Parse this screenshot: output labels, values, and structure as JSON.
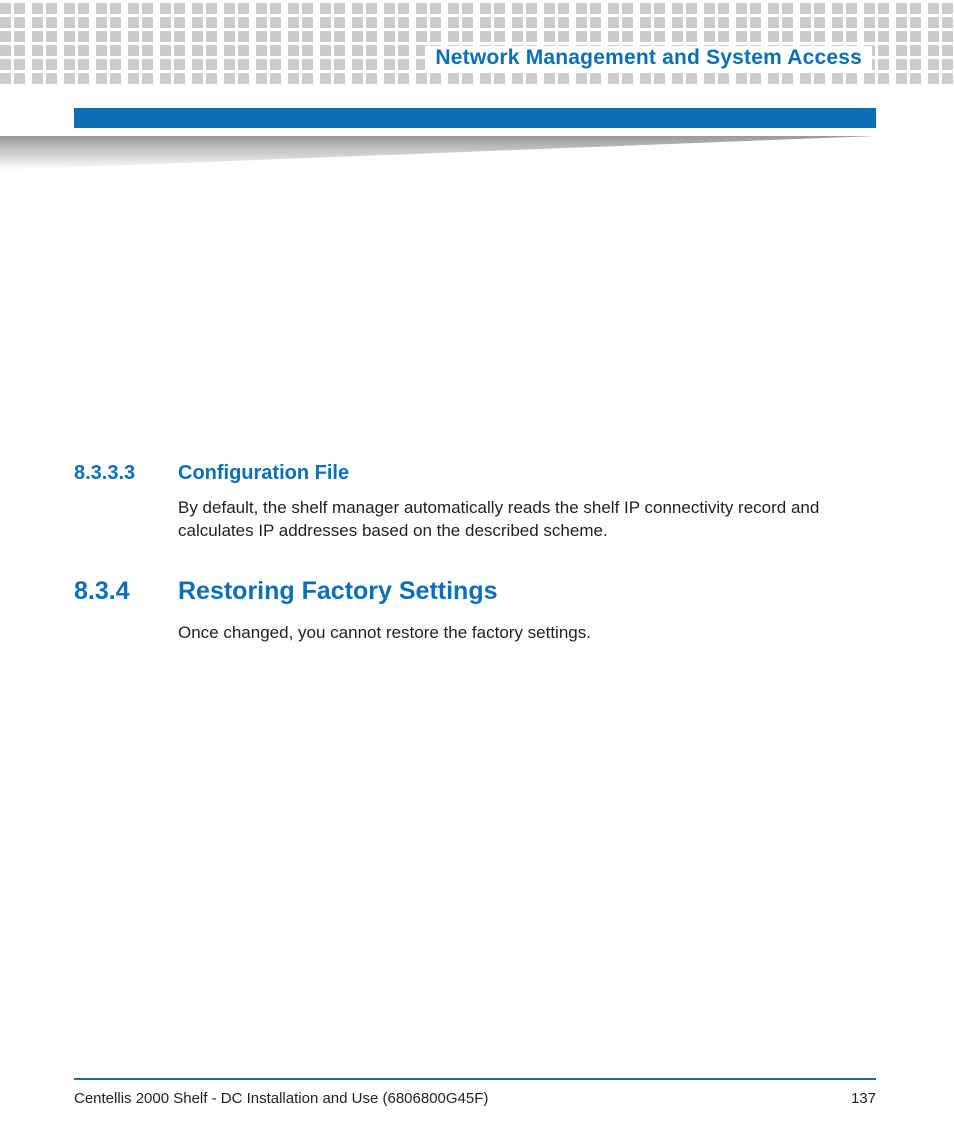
{
  "header": {
    "chapter_title": "Network Management and System Access"
  },
  "sections": [
    {
      "number": "8.3.3.3",
      "title": "Configuration File",
      "level": "h3",
      "body": "By default, the shelf manager automatically reads the shelf IP connectivity record and calculates IP addresses based on the described scheme."
    },
    {
      "number": "8.3.4",
      "title": "Restoring Factory Settings",
      "level": "h2",
      "body": "Once changed, you cannot restore the factory settings."
    }
  ],
  "footer": {
    "doc_title": "Centellis 2000 Shelf - DC Installation and Use (6806800G45F)",
    "page_number": "137"
  }
}
